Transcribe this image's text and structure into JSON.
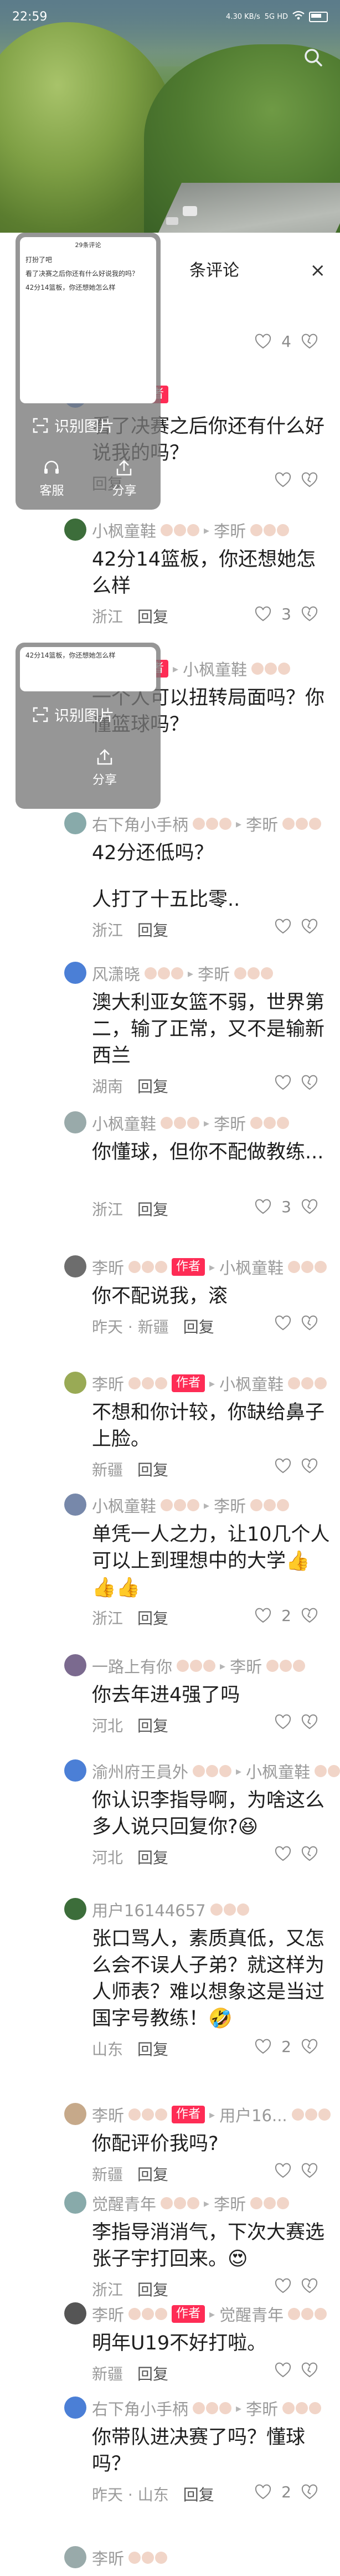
{
  "status": {
    "time": "22:59",
    "network": "4.30 KB/s",
    "signal": "5G HD",
    "battery": ""
  },
  "panel": {
    "title_prefix": "条评论",
    "close": "×"
  },
  "overlay": {
    "ocr_label": "识别图片",
    "service_label": "客服",
    "share_label": "分享",
    "thumb_title": "29条评论",
    "thumb_line1": "打扮了吧",
    "thumb_line2": "看了决赛之后你还有什么好说我的吗？",
    "thumb_line3": "42分14篮板，你还想她怎么样"
  },
  "comments": [
    {
      "user": "",
      "author_tag": "",
      "reply_to": "",
      "text": "",
      "location": "",
      "reply": "回复",
      "likes": "4"
    },
    {
      "user": "",
      "author_tag": "作者",
      "reply_to": "",
      "text": "看了决赛之后你还有什么好说我的吗？",
      "location": "",
      "reply": "回复",
      "likes": ""
    },
    {
      "user": "小枫童鞋",
      "author_tag": "",
      "reply_to": "李昕",
      "text": "42分14篮板，你还想她怎么样",
      "location": "浙江",
      "reply": "回复",
      "likes": "3"
    },
    {
      "user": "",
      "author_tag": "作者",
      "reply_to": "小枫童鞋",
      "text": "一个人可以扭转局面吗？你懂篮球吗？",
      "location": "",
      "reply": "",
      "likes": ""
    },
    {
      "user": "右下角小手柄",
      "author_tag": "",
      "reply_to": "李昕",
      "text": "42分还低吗？",
      "location": "",
      "reply": "",
      "likes": ""
    },
    {
      "user": "",
      "author_tag": "",
      "reply_to": "",
      "text": "人打了十五比零..",
      "location": "浙江",
      "reply": "回复",
      "likes": ""
    },
    {
      "user": "风潇晓",
      "author_tag": "",
      "reply_to": "李昕",
      "text": "澳大利亚女篮不弱，世界第二，输了正常，又不是输新西兰",
      "location": "湖南",
      "reply": "回复",
      "likes": ""
    },
    {
      "user": "小枫童鞋",
      "author_tag": "",
      "reply_to": "李昕",
      "text": "你懂球，但你不配做教练...",
      "location": "浙江",
      "reply": "回复",
      "likes": "3"
    },
    {
      "user": "李昕",
      "author_tag": "作者",
      "reply_to": "小枫童鞋",
      "text": "你不配说我，滚",
      "location": "昨天 · 新疆",
      "reply": "回复",
      "likes": ""
    },
    {
      "user": "李昕",
      "author_tag": "作者",
      "reply_to": "小枫童鞋",
      "text": "不想和你计较，你缺给鼻子上脸。",
      "location": "新疆",
      "reply": "回复",
      "likes": ""
    },
    {
      "user": "小枫童鞋",
      "author_tag": "",
      "reply_to": "李昕",
      "text": "单凭一人之力，让10几个人可以上到理想中的大学👍👍👍",
      "location": "浙江",
      "reply": "回复",
      "likes": "2"
    },
    {
      "user": "一路上有你",
      "author_tag": "",
      "reply_to": "李昕",
      "text": "你去年进4强了吗",
      "location": "河北",
      "reply": "回复",
      "likes": ""
    },
    {
      "user": "渝州府王員外",
      "author_tag": "",
      "reply_to": "小枫童鞋",
      "text": "你认识李指导啊，为啥这么多人说只回复你?😆",
      "location": "河北",
      "reply": "回复",
      "likes": ""
    },
    {
      "user": "用户16144657",
      "author_tag": "",
      "reply_to": "",
      "text": "张口骂人，素质真低，又怎么会不误人子弟？就这样为人师表？难以想象这是当过国字号教练！🤣",
      "location": "山东",
      "reply": "回复",
      "likes": "2"
    },
    {
      "user": "李昕",
      "author_tag": "作者",
      "reply_to": "用户16...",
      "text": "你配评价我吗?",
      "location": "新疆",
      "reply": "回复",
      "likes": ""
    },
    {
      "user": "觉醒青年",
      "author_tag": "",
      "reply_to": "李昕",
      "text": "李指导消消气，下次大赛选张子宇打回来。😍",
      "location": "浙江",
      "reply": "回复",
      "likes": ""
    },
    {
      "user": "李昕",
      "author_tag": "作者",
      "reply_to": "觉醒青年",
      "text": "明年U19不好打啦。",
      "location": "新疆",
      "reply": "回复",
      "likes": ""
    },
    {
      "user": "右下角小手柄",
      "author_tag": "",
      "reply_to": "李昕",
      "text": "你带队进决赛了吗？懂球吗？",
      "location": "昨天 · 山东",
      "reply": "回复",
      "likes": "2"
    },
    {
      "user": "李昕",
      "author_tag": "",
      "reply_to": "",
      "text": "",
      "location": "",
      "reply": "",
      "likes": ""
    }
  ]
}
